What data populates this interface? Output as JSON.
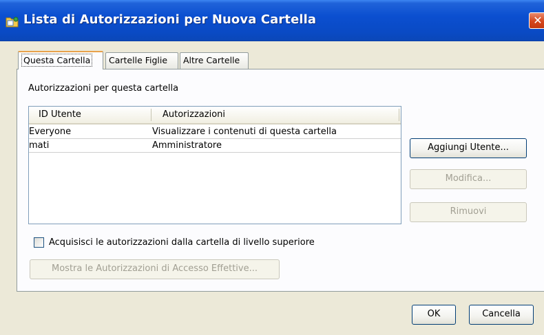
{
  "window": {
    "title": "Lista di Autorizzazioni per Nuova Cartella",
    "close_glyph": "✕"
  },
  "tabs": [
    {
      "label": "Questa Cartella",
      "active": true
    },
    {
      "label": "Cartelle Figlie",
      "active": false
    },
    {
      "label": "Altre Cartelle",
      "active": false
    }
  ],
  "panel": {
    "caption": "Autorizzazioni per questa cartella",
    "table": {
      "headers": [
        "ID Utente",
        "Autorizzazioni"
      ],
      "rows": [
        [
          "Everyone",
          "Visualizzare i contenuti di questa cartella"
        ],
        [
          "mati",
          "Amministratore"
        ]
      ]
    },
    "buttons": {
      "add_user": "Aggiungi Utente...",
      "modify": "Modifica...",
      "remove": "Rimuovi",
      "show_effective": "Mostra le Autorizzazioni di Accesso Effettive..."
    },
    "inherit_checkbox": {
      "label": "Acquisisci le autorizzazioni dalla cartella di livello superiore",
      "checked": false
    }
  },
  "footer": {
    "ok": "OK",
    "cancel": "Cancella"
  }
}
